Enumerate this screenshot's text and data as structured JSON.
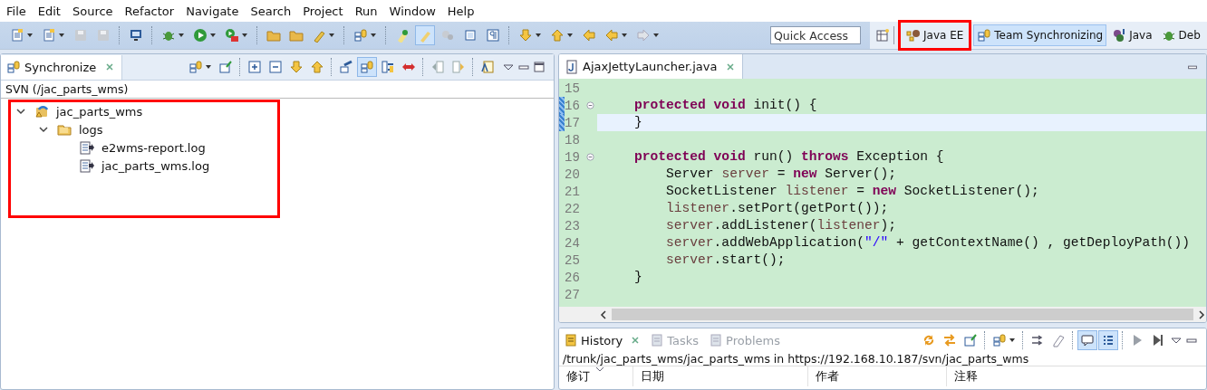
{
  "menu": [
    "File",
    "Edit",
    "Source",
    "Refactor",
    "Navigate",
    "Search",
    "Project",
    "Run",
    "Window",
    "Help"
  ],
  "toolbar": {
    "quick_access": {
      "placeholder": "Quick Access"
    },
    "perspectives": [
      {
        "label": "Java EE",
        "kind": "javaee",
        "selected": false,
        "highlighted": true
      },
      {
        "label": "Team Synchronizing",
        "kind": "team",
        "selected": true,
        "highlighted": false
      },
      {
        "label": "Java",
        "kind": "java",
        "selected": false,
        "highlighted": false
      },
      {
        "label": "Deb",
        "kind": "debug",
        "selected": false,
        "highlighted": false
      }
    ]
  },
  "synchronize": {
    "tab": {
      "label": "Synchronize"
    },
    "heading": "SVN (/jac_parts_wms)",
    "tree": {
      "highlighted": true,
      "items": [
        {
          "label": "jac_parts_wms",
          "kind": "project",
          "expanded": true,
          "children": [
            {
              "label": "logs",
              "kind": "folder",
              "expanded": true,
              "children": [
                {
                  "label": "e2wms-report.log",
                  "kind": "file"
                },
                {
                  "label": "jac_parts_wms.log",
                  "kind": "file"
                }
              ]
            }
          ]
        }
      ]
    }
  },
  "editor": {
    "tab": {
      "label": "AjaxJettyLauncher.java"
    },
    "lines": [
      {
        "number": "15",
        "changed": false,
        "current": false
      },
      {
        "number": "16",
        "fold": true,
        "changed": true,
        "current": false,
        "tokens": [
          {
            "kind": "keyword",
            "text": "    protected"
          },
          {
            "kind": "keyword",
            "text": " void"
          },
          {
            "kind": "plain",
            "text": " init() {"
          }
        ]
      },
      {
        "number": "17",
        "changed": true,
        "current": true,
        "tokens": [
          {
            "kind": "plain",
            "text": "    }"
          }
        ]
      },
      {
        "number": "18",
        "changed": false,
        "current": false
      },
      {
        "number": "19",
        "fold": true,
        "changed": false,
        "current": false,
        "tokens": [
          {
            "kind": "keyword",
            "text": "    protected"
          },
          {
            "kind": "keyword",
            "text": " void"
          },
          {
            "kind": "plain",
            "text": " run() "
          },
          {
            "kind": "keyword",
            "text": "throws"
          },
          {
            "kind": "plain",
            "text": " Exception {"
          }
        ]
      },
      {
        "number": "20",
        "changed": false,
        "current": false,
        "tokens": [
          {
            "kind": "plain",
            "text": "        Server "
          },
          {
            "kind": "variable",
            "text": "server"
          },
          {
            "kind": "plain",
            "text": " = "
          },
          {
            "kind": "keyword",
            "text": "new"
          },
          {
            "kind": "plain",
            "text": " Server();"
          }
        ]
      },
      {
        "number": "21",
        "changed": false,
        "current": false,
        "tokens": [
          {
            "kind": "plain",
            "text": "        SocketListener "
          },
          {
            "kind": "variable",
            "text": "listener"
          },
          {
            "kind": "plain",
            "text": " = "
          },
          {
            "kind": "keyword",
            "text": "new"
          },
          {
            "kind": "plain",
            "text": " SocketListener();"
          }
        ]
      },
      {
        "number": "22",
        "changed": false,
        "current": false,
        "tokens": [
          {
            "kind": "variable",
            "text": "        listener"
          },
          {
            "kind": "plain",
            "text": ".setPort(getPort());"
          }
        ]
      },
      {
        "number": "23",
        "changed": false,
        "current": false,
        "tokens": [
          {
            "kind": "variable",
            "text": "        server"
          },
          {
            "kind": "plain",
            "text": ".addListener("
          },
          {
            "kind": "variable",
            "text": "listener"
          },
          {
            "kind": "plain",
            "text": ");"
          }
        ]
      },
      {
        "number": "24",
        "changed": false,
        "current": false,
        "tokens": [
          {
            "kind": "variable",
            "text": "        server"
          },
          {
            "kind": "plain",
            "text": ".addWebApplication("
          },
          {
            "kind": "string",
            "text": "\"/\""
          },
          {
            "kind": "plain",
            "text": " + getContextName() , getDeployPath())"
          }
        ]
      },
      {
        "number": "25",
        "changed": false,
        "current": false,
        "tokens": [
          {
            "kind": "variable",
            "text": "        server"
          },
          {
            "kind": "plain",
            "text": ".start();"
          }
        ]
      },
      {
        "number": "26",
        "changed": false,
        "current": false,
        "tokens": [
          {
            "kind": "plain",
            "text": "    }"
          }
        ]
      },
      {
        "number": "27",
        "changed": false,
        "current": false
      }
    ]
  },
  "history": {
    "tabs": [
      {
        "label": "History",
        "selected": true
      },
      {
        "label": "Tasks",
        "selected": false
      },
      {
        "label": "Problems",
        "selected": false
      }
    ],
    "path": "/trunk/jac_parts_wms/jac_parts_wms in https://192.168.10.187/svn/jac_parts_wms",
    "columns": [
      {
        "label": "修订",
        "sorted": true
      },
      {
        "label": "日期",
        "sorted": false
      },
      {
        "label": "作者",
        "sorted": false
      },
      {
        "label": "注释",
        "sorted": false
      }
    ]
  }
}
